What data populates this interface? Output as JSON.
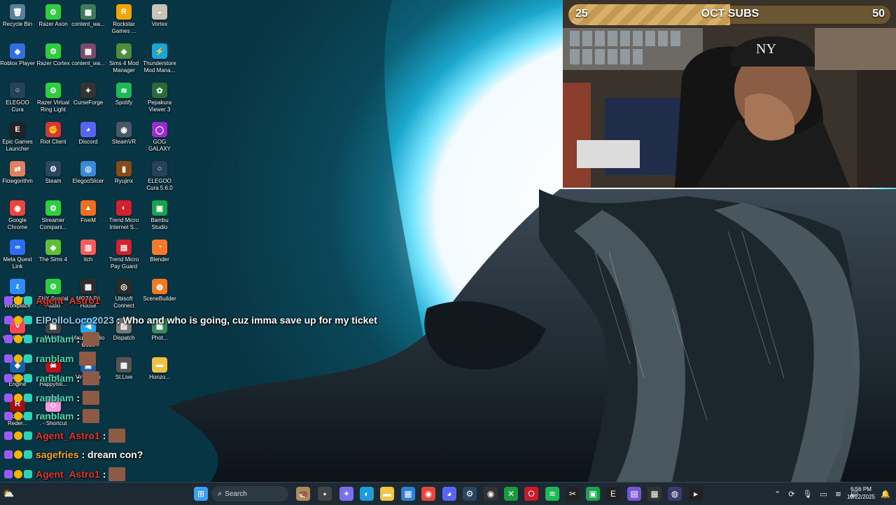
{
  "desktop": {
    "icons": [
      {
        "id": "recycle-bin",
        "label": "Recycle Bin",
        "glyph": "🗑",
        "color": "#5a7f9a"
      },
      {
        "id": "razer-axon",
        "label": "Razer Axon",
        "glyph": "⚙",
        "color": "#2ecc40"
      },
      {
        "id": "content-1",
        "label": "content_wa...",
        "glyph": "▦",
        "color": "#3f7a5c"
      },
      {
        "id": "rockstar",
        "label": "Rockstar Games ...",
        "glyph": "R",
        "color": "#f0a500"
      },
      {
        "id": "vortex",
        "label": "Vortex",
        "glyph": "◒",
        "color": "#c9c2b6"
      },
      {
        "id": "roblox",
        "label": "Roblox Player",
        "glyph": "◆",
        "color": "#2f6fe0"
      },
      {
        "id": "razer-cortex",
        "label": "Razer Cortex",
        "glyph": "⚙",
        "color": "#2ecc40"
      },
      {
        "id": "content-2",
        "label": "content_wa...",
        "glyph": "▦",
        "color": "#7a4b6e"
      },
      {
        "id": "sims4mm",
        "label": "Sims 4 Mod Manager",
        "glyph": "◆",
        "color": "#4b8f3a"
      },
      {
        "id": "thunderstore",
        "label": "Thunderstore Mod Mana...",
        "glyph": "⚡",
        "color": "#18a6d8"
      },
      {
        "id": "elegoo-cura",
        "label": "ELEGOO Cura",
        "glyph": "○",
        "color": "#26415a"
      },
      {
        "id": "razer-vrl",
        "label": "Razer Virtual Ring Light",
        "glyph": "⚙",
        "color": "#2ecc40"
      },
      {
        "id": "curseforge",
        "label": "CurseForge",
        "glyph": "✦",
        "color": "#333333"
      },
      {
        "id": "spotify",
        "label": "Spotify",
        "glyph": "≋",
        "color": "#1db954"
      },
      {
        "id": "pepakura",
        "label": "Pepakura Viewer 3",
        "glyph": "✿",
        "color": "#2b6b3a"
      },
      {
        "id": "epic",
        "label": "Epic Games Launcher",
        "glyph": "E",
        "color": "#222222"
      },
      {
        "id": "riot",
        "label": "Riot Client",
        "glyph": "✊",
        "color": "#d13639"
      },
      {
        "id": "discord",
        "label": "Discord",
        "glyph": "◕",
        "color": "#5865f2"
      },
      {
        "id": "steamvr",
        "label": "SteamVR",
        "glyph": "◉",
        "color": "#4a5864"
      },
      {
        "id": "gog",
        "label": "GOG GALAXY",
        "glyph": "◯",
        "color": "#9b2ccf"
      },
      {
        "id": "flowgorithm",
        "label": "Flowgorithm",
        "glyph": "⇄",
        "color": "#e08060"
      },
      {
        "id": "steam",
        "label": "Steam",
        "glyph": "⚙",
        "color": "#2a475e"
      },
      {
        "id": "elegooslicer",
        "label": "ElegooSlicer",
        "glyph": "◎",
        "color": "#3a8ad8"
      },
      {
        "id": "ryujinx",
        "label": "Ryujinx",
        "glyph": "▮",
        "color": "#8a4a18"
      },
      {
        "id": "elegoo-cura-56",
        "label": "ELEGOO Cura 5.6.0",
        "glyph": "○",
        "color": "#26415a"
      },
      {
        "id": "chrome",
        "label": "Google Chrome",
        "glyph": "◉",
        "color": "#e8453c"
      },
      {
        "id": "streamer-companion",
        "label": "Streamer Compani...",
        "glyph": "⚙",
        "color": "#2ecc40"
      },
      {
        "id": "fivem",
        "label": "FiveM",
        "glyph": "▲",
        "color": "#f07020"
      },
      {
        "id": "trend-micro-is",
        "label": "Trend Micro Internet S...",
        "glyph": "◐",
        "color": "#d3202e"
      },
      {
        "id": "bambu",
        "label": "Bambu Studio",
        "glyph": "▣",
        "color": "#19a34a"
      },
      {
        "id": "meta-quest",
        "label": "Meta Quest Link",
        "glyph": "∞",
        "color": "#2b6ef2"
      },
      {
        "id": "sims4",
        "label": "The Sims 4",
        "glyph": "◆",
        "color": "#5fbf3a"
      },
      {
        "id": "itch",
        "label": "itch",
        "glyph": "▥",
        "color": "#fa5c5c"
      },
      {
        "id": "trend-micro-pg",
        "label": "Trend Micro Pay Guard",
        "glyph": "▤",
        "color": "#d3202e"
      },
      {
        "id": "blender",
        "label": "Blender",
        "glyph": "◔",
        "color": "#f5792a"
      },
      {
        "id": "zoom",
        "label": "Zoom Workplace",
        "glyph": "z",
        "color": "#2d8cff"
      },
      {
        "id": "thx",
        "label": "THX Spatial Audio",
        "glyph": "⚙",
        "color": "#2ecc40"
      },
      {
        "id": "moza",
        "label": "MOZA Pit House",
        "glyph": "▩",
        "color": "#2d2d2d"
      },
      {
        "id": "ubisoft",
        "label": "Ubisoft Connect",
        "glyph": "◎",
        "color": "#2b2b2b"
      },
      {
        "id": "scenebuilder",
        "label": "SceneBuilder",
        "glyph": "◍",
        "color": "#f07a20"
      },
      {
        "id": "valorant",
        "label": "VALORANT",
        "glyph": "V",
        "color": "#fd4556"
      },
      {
        "id": "mmm",
        "label": "...M Alert...",
        "glyph": "▦",
        "color": "#444444"
      },
      {
        "id": "vscode",
        "label": "Visual Studio Code",
        "glyph": "◀",
        "color": "#23a8f2"
      },
      {
        "id": "dispatch",
        "label": "Dispatch",
        "glyph": "▧",
        "color": "#777777"
      },
      {
        "id": "photo",
        "label": "Phot...",
        "glyph": "▦",
        "color": "#3b8a5a"
      },
      {
        "id": "wallpaper-engine",
        "label": "Wallpaper Engine",
        "glyph": "◈",
        "color": "#1b5fa8"
      },
      {
        "id": "happyhill",
        "label": "The Happyhill...",
        "glyph": "☠",
        "color": "#b5121b"
      },
      {
        "id": "virtualbox",
        "label": "VirtualBox",
        "glyph": "▣",
        "color": "#1f5ea8"
      },
      {
        "id": "stlive",
        "label": "St.Live",
        "glyph": "▦",
        "color": "#555555"
      },
      {
        "id": "honzo",
        "label": "Honzo...",
        "glyph": "▬",
        "color": "#f0c040"
      },
      {
        "id": "red-dead",
        "label": "Red Dead Reder...",
        "glyph": "R",
        "color": "#a01010"
      },
      {
        "id": "yandere",
        "label": "YandereSim... - Shortcut",
        "glyph": "◇",
        "color": "#f59be0"
      }
    ]
  },
  "overlay": {
    "subs": {
      "current": "25",
      "title": "OCT SUBS",
      "goal": "50",
      "progress_fraction": 0.5
    },
    "chat": [
      {
        "user": "Agent_Astro1",
        "user_color": "#e0382c",
        "text": "",
        "emote": false
      },
      {
        "user": "ElPolloLoco2023",
        "user_color": "#8fd0f4",
        "text": ": Who and who is going, cuz imma save up for my ticket",
        "emote": false
      },
      {
        "user": "ranblam",
        "user_color": "#39e0b8",
        "text": ":",
        "emote": true
      },
      {
        "user": "ranblam",
        "user_color": "#39e0b8",
        "text": "",
        "emote": true
      },
      {
        "user": "ranblam",
        "user_color": "#39e0b8",
        "text": ":",
        "emote": true
      },
      {
        "user": "ranblam",
        "user_color": "#39e0b8",
        "text": ":",
        "emote": true
      },
      {
        "user": "ranblam",
        "user_color": "#39e0b8",
        "text": ":",
        "emote": true
      },
      {
        "user": "Agent_Astro1",
        "user_color": "#e0382c",
        "text": ":",
        "emote": true
      },
      {
        "user": "sagefries",
        "user_color": "#f1a63b",
        "text": ": dream con?",
        "emote": false
      },
      {
        "user": "Agent_Astro1",
        "user_color": "#e0382c",
        "text": ":",
        "emote": true
      },
      {
        "user": "Agent_Astro1",
        "user_color": "#e0382c",
        "text": "",
        "emote": true
      }
    ]
  },
  "taskbar": {
    "search_label": "Search",
    "apps": [
      {
        "id": "start",
        "glyph": "⊞",
        "color": "#3aa0ff"
      },
      {
        "id": "widgets",
        "glyph": "🦔",
        "color": "#b08a58"
      },
      {
        "id": "task-view",
        "glyph": "▪",
        "color": "#444"
      },
      {
        "id": "copilot",
        "glyph": "✦",
        "color": "#7a6ff0"
      },
      {
        "id": "edge",
        "glyph": "◐",
        "color": "#1f9bd8"
      },
      {
        "id": "explorer",
        "glyph": "▬",
        "color": "#f5c542"
      },
      {
        "id": "store",
        "glyph": "▦",
        "color": "#2d7fd8"
      },
      {
        "id": "chrome",
        "glyph": "◉",
        "color": "#e8453c"
      },
      {
        "id": "discord",
        "glyph": "◕",
        "color": "#5865f2"
      },
      {
        "id": "steam",
        "glyph": "⚙",
        "color": "#2a475e"
      },
      {
        "id": "obs",
        "glyph": "◉",
        "color": "#333"
      },
      {
        "id": "xbox",
        "glyph": "✕",
        "color": "#1a9c3e"
      },
      {
        "id": "opera",
        "glyph": "O",
        "color": "#d1182b"
      },
      {
        "id": "spotify",
        "glyph": "≋",
        "color": "#1db954"
      },
      {
        "id": "capcut",
        "glyph": "✂",
        "color": "#222"
      },
      {
        "id": "app-green",
        "glyph": "▣",
        "color": "#19a34a"
      },
      {
        "id": "epic",
        "glyph": "E",
        "color": "#222"
      },
      {
        "id": "notes",
        "glyph": "▤",
        "color": "#7a55d8"
      },
      {
        "id": "app-dark",
        "glyph": "▦",
        "color": "#333"
      },
      {
        "id": "app-purple",
        "glyph": "◍",
        "color": "#3b3b6e"
      },
      {
        "id": "terminal",
        "glyph": "▸",
        "color": "#222"
      }
    ],
    "clock": {
      "time": "6:56 PM",
      "date": "10/22/2025"
    }
  }
}
